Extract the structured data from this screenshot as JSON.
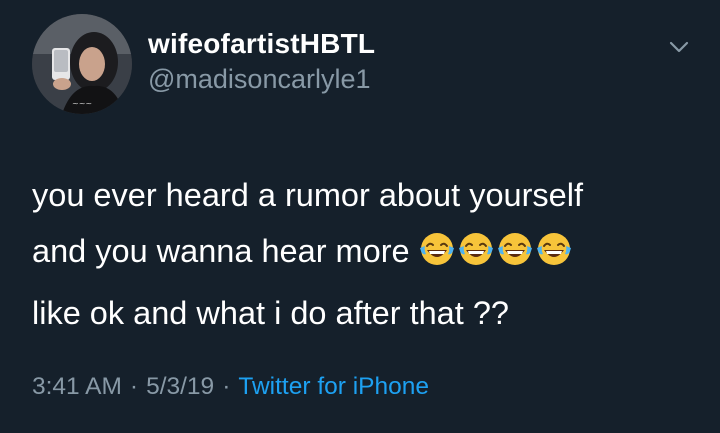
{
  "user": {
    "display_name": "wifeofartistHBTL",
    "handle": "@madisoncarlyle1",
    "avatar_icon": "profile-photo-avatar"
  },
  "tweet": {
    "line1": "you ever heard a rumor about yourself",
    "line2": "and you wanna hear more",
    "line3": "like ok and what i do after that ??",
    "emoji": [
      "face-with-tears-of-joy",
      "face-with-tears-of-joy",
      "face-with-tears-of-joy",
      "face-with-tears-of-joy"
    ]
  },
  "meta": {
    "time": "3:41 AM",
    "date": "5/3/19",
    "separator": "·",
    "source": "Twitter for iPhone"
  },
  "icons": {
    "menu": "chevron-down-icon"
  },
  "colors": {
    "background": "#15202b",
    "text": "#ffffff",
    "secondary": "#8899a6",
    "link": "#1da1f2"
  }
}
